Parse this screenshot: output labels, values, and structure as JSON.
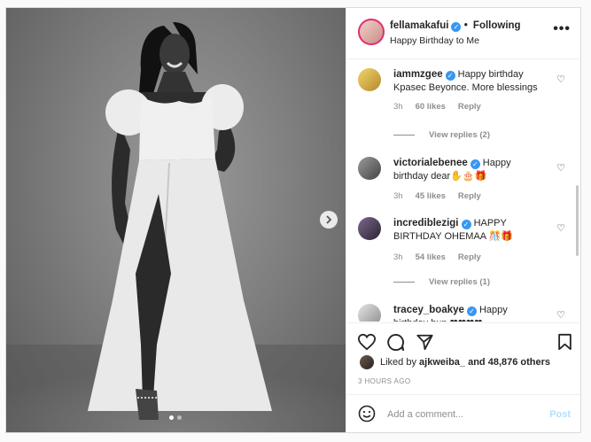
{
  "post": {
    "username": "fellamakafui",
    "follow_status": "Following",
    "caption": "Happy Birthday to Me",
    "more_label": "•••",
    "carousel_dots": 2
  },
  "comments": [
    {
      "user": "iammzgee",
      "text": "Happy birthday Kpasec Beyonce. More blessings",
      "time": "3h",
      "likes": "60 likes",
      "reply": "Reply",
      "view_replies": "View replies (2)"
    },
    {
      "user": "victorialebenee",
      "text": "Happy birthday dear✋🎂🎁",
      "time": "3h",
      "likes": "45 likes",
      "reply": "Reply"
    },
    {
      "user": "incrediblezigi",
      "text": "HAPPY BIRTHDAY OHEMAA 🎊🎁",
      "time": "3h",
      "likes": "54 likes",
      "reply": "Reply",
      "view_replies": "View replies (1)"
    },
    {
      "user": "tracey_boakye",
      "text": "Happy birthday hun ❤❤❤❤"
    }
  ],
  "likes_line": {
    "prefix": "Liked by",
    "user": "ajkweiba_",
    "suffix": "and 48,876 others"
  },
  "timestamp": "3 HOURS AGO",
  "add_comment": {
    "placeholder": "Add a comment...",
    "post_label": "Post"
  },
  "colors": {
    "accent": "#3897f0",
    "story_ring": "#e1306c",
    "muted": "#8e8e8e",
    "heart": "#c0152f"
  },
  "icons": [
    "next-arrow-icon",
    "more-icon",
    "heart-icon",
    "comment-icon",
    "share-icon",
    "bookmark-icon",
    "emoji-icon",
    "verified-badge-icon"
  ]
}
